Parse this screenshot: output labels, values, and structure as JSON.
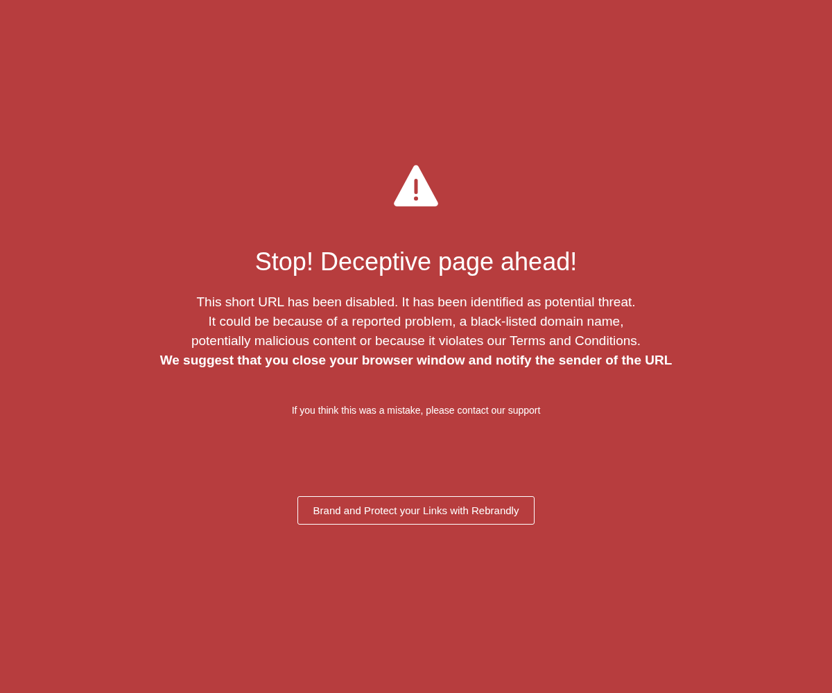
{
  "title": "Stop! Deceptive page ahead!",
  "message_lines": [
    "This short URL has been disabled. It has been identified as potential threat.",
    "It could be because of a reported problem, a black-listed domain name,",
    "potentially malicious content or because it violates our Terms and Conditions."
  ],
  "warning": "We suggest that you close your browser window and notify the sender of the URL",
  "contact_text": "If you think this was a mistake, please contact our support",
  "button": {
    "label": "Brand and Protect your Links with Rebrandly"
  }
}
